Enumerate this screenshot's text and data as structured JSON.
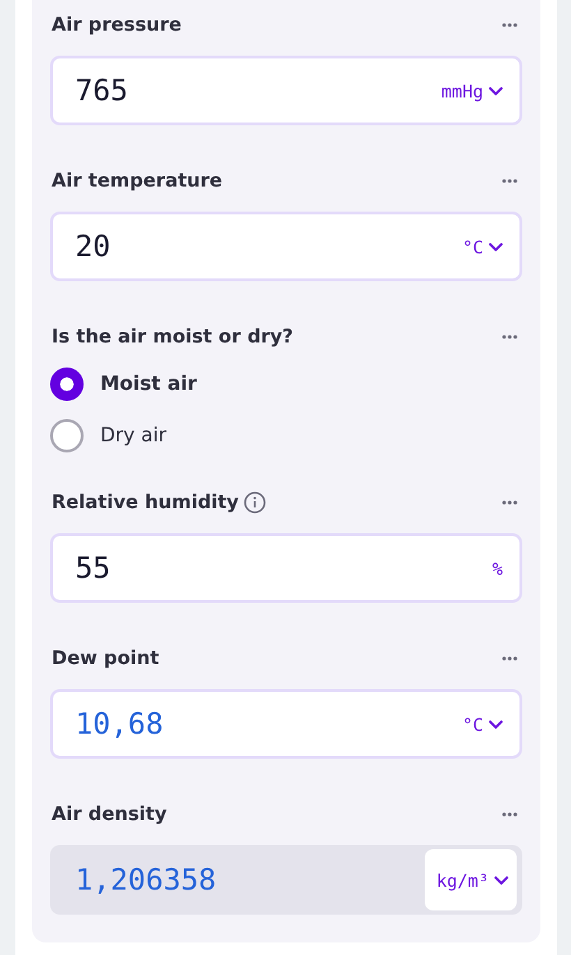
{
  "fields": [
    {
      "kind": "number",
      "label": "Air pressure",
      "info": false,
      "value": "765",
      "computed": false,
      "readonly": false,
      "unit": "mmHg",
      "unit_dropdown": true
    },
    {
      "kind": "number",
      "label": "Air temperature",
      "info": false,
      "value": "20",
      "computed": false,
      "readonly": false,
      "unit": "°C",
      "unit_dropdown": true
    },
    {
      "kind": "radio",
      "label": "Is the air moist or dry?",
      "info": false,
      "options": [
        {
          "label": "Moist air",
          "selected": true
        },
        {
          "label": "Dry air",
          "selected": false
        }
      ]
    },
    {
      "kind": "number",
      "label": "Relative humidity",
      "info": true,
      "value": "55",
      "computed": false,
      "readonly": false,
      "unit": "%",
      "unit_dropdown": false
    },
    {
      "kind": "number",
      "label": "Dew point",
      "info": false,
      "value": "10,68",
      "computed": true,
      "readonly": false,
      "unit": "°C",
      "unit_dropdown": true
    },
    {
      "kind": "number",
      "label": "Air density",
      "info": false,
      "value": "1,206358",
      "computed": true,
      "readonly": true,
      "unit": "kg/m³",
      "unit_dropdown": true
    }
  ]
}
